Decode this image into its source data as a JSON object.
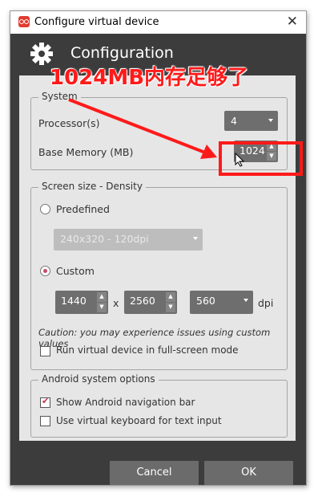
{
  "window": {
    "title": "Configure virtual device"
  },
  "header": {
    "title": "Configuration"
  },
  "system": {
    "legend": "System",
    "processors_label": "Processor(s)",
    "processors_value": "4",
    "memory_label": "Base Memory (MB)",
    "memory_value": "1024"
  },
  "screen": {
    "legend": "Screen size - Density",
    "predefined_label": "Predefined",
    "predefined_value": "240x320 - 120dpi",
    "custom_label": "Custom",
    "width": "1440",
    "x_sep": "x",
    "height": "2560",
    "dpi_value": "560",
    "dpi_label": "dpi",
    "caution": "Caution: you may experience issues using custom values",
    "fullscreen_label": "Run virtual device in full-screen mode",
    "selected": "custom",
    "fullscreen_checked": false
  },
  "android": {
    "legend": "Android system options",
    "navbar_label": "Show Android navigation bar",
    "navbar_checked": true,
    "keyboard_label": "Use virtual keyboard for text input",
    "keyboard_checked": false
  },
  "buttons": {
    "cancel": "Cancel",
    "ok": "OK"
  },
  "annotation": {
    "text": "1024MB内存足够了",
    "color": "#ff1a1a"
  },
  "colors": {
    "accent": "#c84a6a",
    "header_bg": "#3c3c3c",
    "panel_bg": "#e6e6e6"
  }
}
